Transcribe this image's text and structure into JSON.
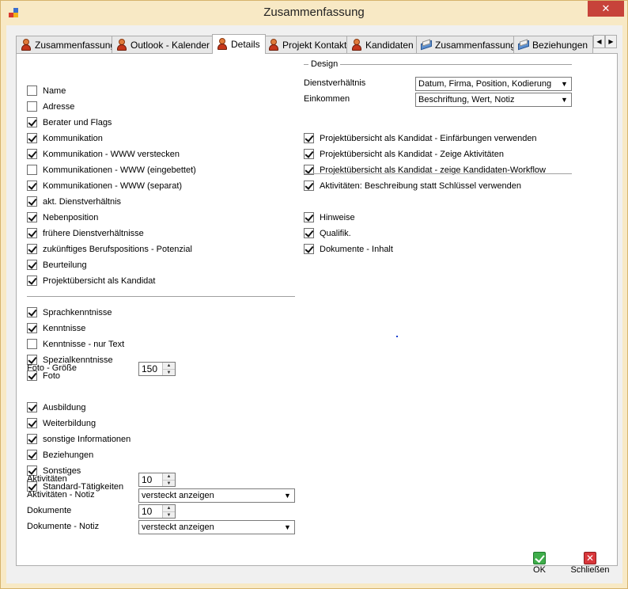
{
  "window": {
    "title": "Zusammenfassung",
    "close_glyph": "✕"
  },
  "tabs": [
    {
      "label": "Zusammenfassung",
      "icon": "person-icon"
    },
    {
      "label": "Outlook - Kalender",
      "icon": "person-icon"
    },
    {
      "label": "Details",
      "icon": "person-icon",
      "active": true
    },
    {
      "label": "Projekt Kontakt",
      "icon": "person-icon"
    },
    {
      "label": "Kandidaten",
      "icon": "person-icon"
    },
    {
      "label": "Zusammenfassung",
      "icon": "book-icon"
    },
    {
      "label": "Beziehungen",
      "icon": "book-icon"
    }
  ],
  "tab_scroll": {
    "left": "◀",
    "right": "▶"
  },
  "left": {
    "checks1": [
      {
        "label": "Name",
        "checked": false
      },
      {
        "label": "Adresse",
        "checked": false
      },
      {
        "label": "Berater und Flags",
        "checked": true
      },
      {
        "label": "Kommunikation",
        "checked": true
      },
      {
        "label": "Kommunikation - WWW verstecken",
        "checked": true
      },
      {
        "label": "Kommunikationen - WWW (eingebettet)",
        "checked": false
      },
      {
        "label": "Kommunikationen - WWW (separat)",
        "checked": true
      },
      {
        "label": "akt. Dienstverhältnis",
        "checked": true
      },
      {
        "label": "Nebenposition",
        "checked": true
      },
      {
        "label": "frühere Dienstverhältnisse",
        "checked": true
      },
      {
        "label": "zukünftiges Berufspositions - Potenzial",
        "checked": true
      },
      {
        "label": "Beurteilung",
        "checked": true
      },
      {
        "label": "Projektübersicht als Kandidat",
        "checked": true
      }
    ],
    "checks2": [
      {
        "label": "Sprachkenntnisse",
        "checked": true
      },
      {
        "label": "Kenntnisse",
        "checked": true
      },
      {
        "label": "Kenntnisse - nur Text",
        "checked": false
      },
      {
        "label": "Spezialkenntnisse",
        "checked": true
      },
      {
        "label": "Foto",
        "checked": true
      }
    ],
    "foto_size": {
      "label": "Foto - Größe",
      "value": "150"
    },
    "checks3": [
      {
        "label": "Ausbildung",
        "checked": true
      },
      {
        "label": "Weiterbildung",
        "checked": true
      },
      {
        "label": "sonstige Informationen",
        "checked": true
      },
      {
        "label": "Beziehungen",
        "checked": true
      },
      {
        "label": "Sonstiges",
        "checked": true
      },
      {
        "label": "Standard-Tätigkeiten",
        "checked": true
      }
    ],
    "aktivitaeten": {
      "label": "Aktivitäten",
      "value": "10"
    },
    "aktivitaeten_notiz": {
      "label": "Aktivitäten - Notiz",
      "value": "versteckt anzeigen"
    },
    "dokumente": {
      "label": "Dokumente",
      "value": "10"
    },
    "dokumente_notiz": {
      "label": "Dokumente - Notiz",
      "value": "versteckt anzeigen"
    }
  },
  "right": {
    "design_label": "Design",
    "dienstverhaeltnis": {
      "label": "Dienstverhältnis",
      "value": "Datum, Firma, Position, Kodierung"
    },
    "einkommen": {
      "label": "Einkommen",
      "value": "Beschriftung, Wert, Notiz"
    },
    "checks1": [
      {
        "label": "Projektübersicht als Kandidat - Einfärbungen verwenden",
        "checked": true
      },
      {
        "label": "Projektübersicht als Kandidat - Zeige Aktivitäten",
        "checked": true
      },
      {
        "label": "Projektübersicht als Kandidat - zeige Kandidaten-Workflow",
        "checked": true
      },
      {
        "label": "Aktivitäten: Beschreibung statt Schlüssel verwenden",
        "checked": true
      }
    ],
    "checks2": [
      {
        "label": "Hinweise",
        "checked": true
      },
      {
        "label": "Qualifik.",
        "checked": true
      },
      {
        "label": "Dokumente - Inhalt",
        "checked": true
      }
    ]
  },
  "buttons": {
    "ok": "OK",
    "close": "Schließen",
    "close_glyph": "✕"
  },
  "glyphs": {
    "spin_up": "▲",
    "spin_down": "▼",
    "combo_arrow": "▼"
  }
}
